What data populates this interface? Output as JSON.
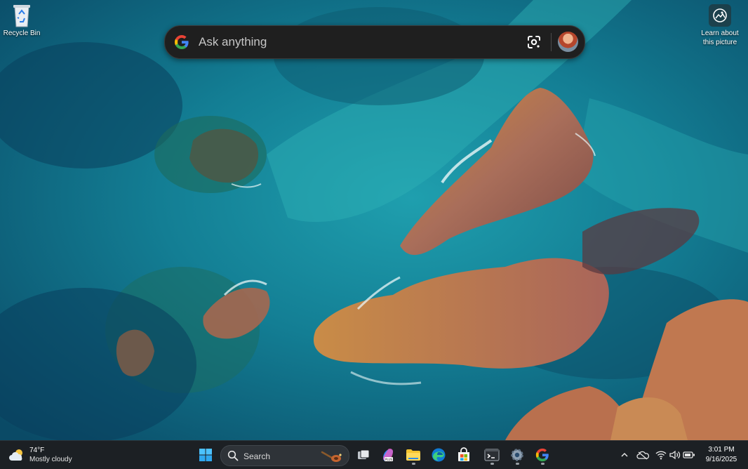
{
  "desktop": {
    "recycle_bin_label": "Recycle Bin",
    "learn_label_line1": "Learn about",
    "learn_label_line2": "this picture"
  },
  "google_bar": {
    "placeholder": "Ask anything",
    "logo_icon": "google-g-icon",
    "lens_icon": "google-lens-icon",
    "avatar_icon": "user-avatar"
  },
  "taskbar": {
    "weather": {
      "temperature": "74°F",
      "condition": "Mostly cloudy",
      "icon": "partly-cloudy-icon"
    },
    "search_placeholder": "Search",
    "pinned": [
      {
        "name": "start-button",
        "icon": "windows-logo-icon"
      },
      {
        "name": "task-view",
        "icon": "task-view-icon"
      },
      {
        "name": "copilot",
        "icon": "copilot-icon"
      },
      {
        "name": "file-explorer",
        "icon": "folder-icon"
      },
      {
        "name": "edge",
        "icon": "edge-icon"
      },
      {
        "name": "store",
        "icon": "store-icon"
      },
      {
        "name": "terminal",
        "icon": "terminal-icon"
      },
      {
        "name": "settings",
        "icon": "gear-icon"
      },
      {
        "name": "chrome",
        "icon": "google-g-icon"
      }
    ],
    "tray": {
      "chevron_icon": "chevron-up-icon",
      "onedrive_icon": "cloud-icon",
      "wifi_icon": "wifi-icon",
      "volume_icon": "speaker-icon",
      "battery_icon": "battery-icon"
    },
    "clock": {
      "time": "3:01 PM",
      "date": "9/16/2025"
    }
  },
  "colors": {
    "taskbar_bg": "#1c2024",
    "search_bar_bg": "#1f1f1f",
    "sea_deep": "#0b4f6c",
    "sea_light": "#1f9aa8",
    "rock": "#b57a52"
  }
}
